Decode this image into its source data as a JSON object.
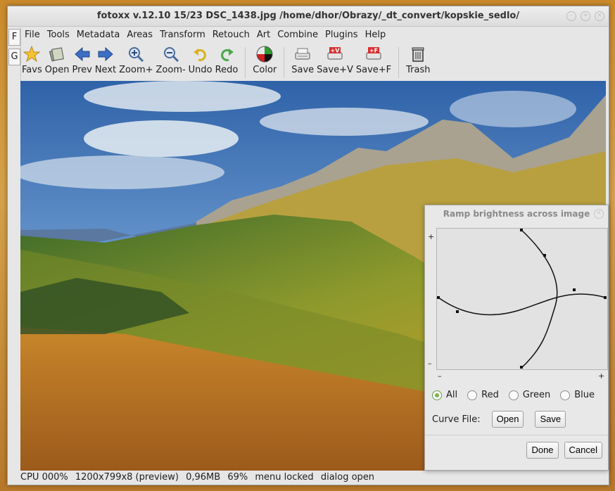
{
  "window": {
    "title": "fotoxx v.12.10   15/23  DSC_1438.jpg  /home/dhor/Obrazy/_dt_convert/kopskie_sedlo/",
    "controls": [
      "–",
      "+",
      "×"
    ]
  },
  "side_tabs": [
    "F",
    "G"
  ],
  "menu": [
    "Metadata",
    "Areas",
    "Transform",
    "Retouch",
    "Art",
    "Combine",
    "Plugins",
    "Help"
  ],
  "menu_file": "File",
  "menu_tools": "Tools",
  "toolbar": {
    "favs": "Favs",
    "open": "Open",
    "prev": "Prev",
    "next": "Next",
    "zoom_in": "Zoom+",
    "zoom_out": "Zoom-",
    "undo": "Undo",
    "redo": "Redo",
    "color": "Color",
    "save": "Save",
    "save_v": "Save+V",
    "save_f": "Save+F",
    "trash": "Trash"
  },
  "status": {
    "cpu": "CPU 000%",
    "size": "1200x799x8 (preview)",
    "mem": "0,96MB",
    "zoom": "69%",
    "menu": "menu locked",
    "dialog": "dialog open"
  },
  "dialog": {
    "title": "Ramp brightness across image",
    "y_plus": "+",
    "y_minus": "–",
    "x_minus": "–",
    "x_plus": "+",
    "radios": [
      {
        "label": "All",
        "checked": true
      },
      {
        "label": "Red",
        "checked": false
      },
      {
        "label": "Green",
        "checked": false
      },
      {
        "label": "Blue",
        "checked": false
      }
    ],
    "curve_file_label": "Curve File:",
    "open_button": "Open",
    "save_button": "Save",
    "done_button": "Done",
    "cancel_button": "Cancel"
  },
  "colors": {
    "radio_accent": "#7fb34e",
    "sky_blue": "#4f7fbf",
    "grass_orange": "#c8862a"
  }
}
